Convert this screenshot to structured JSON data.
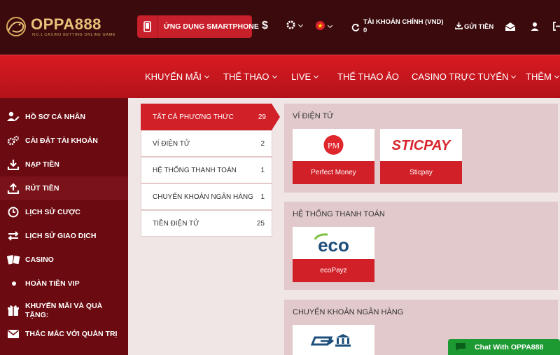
{
  "header": {
    "brand": "OPPA888",
    "brand_tagline": "NO.1 CASINO BETTING ONLINE GAME",
    "app_button_label": "ỨNG DỤNG SMARTPHONE",
    "account_line1": "TÀI KHOẢN CHÍNH (VND)",
    "account_balance": "0",
    "deposit_label": "GỬI TIỀN"
  },
  "nav": {
    "items": [
      {
        "label": "KHUYẾN MÃI",
        "dropdown": true
      },
      {
        "label": "THỂ THAO",
        "dropdown": true
      },
      {
        "label": "LIVE",
        "dropdown": true
      },
      {
        "label": "THỂ THAO ẢO",
        "dropdown": false
      },
      {
        "label": "CASINO TRỰC TUYẾN",
        "dropdown": true
      },
      {
        "label": "THÊM",
        "dropdown": true
      }
    ]
  },
  "sidebar": {
    "items": [
      {
        "label": "HỒ SƠ CÁ NHÂN",
        "icon": "user-edit-icon"
      },
      {
        "label": "CÀI ĐẶT TÀI KHOẢN",
        "icon": "gears-icon"
      },
      {
        "label": "NẠP TIỀN",
        "icon": "download-icon"
      },
      {
        "label": "RÚT TIỀN",
        "icon": "upload-icon",
        "active": true
      },
      {
        "label": "LỊCH SỬ CƯỢC",
        "icon": "clock-icon"
      },
      {
        "label": "LỊCH SỬ GIAO DỊCH",
        "icon": "exchange-icon"
      },
      {
        "label": "CASINO",
        "icon": "cards-icon"
      },
      {
        "label": "HOÀN TIỀN VIP",
        "icon": "dot-icon"
      },
      {
        "label_line1": "KHUYẾN MÃI VÀ QUÀ",
        "label_line2": "TẶNG:",
        "icon": "gift-icon"
      },
      {
        "label": "THẮC MẮC VỚI QUẢN TRỊ",
        "icon": "envelope-icon"
      }
    ]
  },
  "methods": {
    "items": [
      {
        "label": "TẤT CẢ PHƯƠNG THỨC",
        "count": "29",
        "active": true
      },
      {
        "label": "VÍ ĐIỆN TỬ",
        "count": "2"
      },
      {
        "label": "HỆ THỐNG THANH TOÁN",
        "count": "1"
      },
      {
        "label": "CHUYỂN KHOẢN NGÂN HÀNG",
        "count": "1"
      },
      {
        "label": "TIỀN ĐIỆN TỬ",
        "count": "25"
      }
    ]
  },
  "panels": {
    "ewallet": {
      "title": "VÍ ĐIỆN TỬ",
      "cards": [
        {
          "label": "Perfect Money",
          "logo_text": "PM"
        },
        {
          "label": "Sticpay",
          "logo_text": "STICPAY"
        }
      ]
    },
    "payment_system": {
      "title": "HỆ THỐNG THANH TOÁN",
      "cards": [
        {
          "label": "ecoPayz",
          "logo_text": "eco"
        }
      ]
    },
    "bank_transfer": {
      "title": "CHUYỂN KHOẢN NGÂN HÀNG"
    }
  },
  "chat": {
    "label": "Chat With OPPA888"
  },
  "colors": {
    "header_bg": "#3b0a0d",
    "nav_red": "#c8151d",
    "sidebar_bg": "#6b0a10",
    "accent_red": "#d12028",
    "panel_bg": "#e2c9cb",
    "chat_green": "#1e9a33"
  }
}
